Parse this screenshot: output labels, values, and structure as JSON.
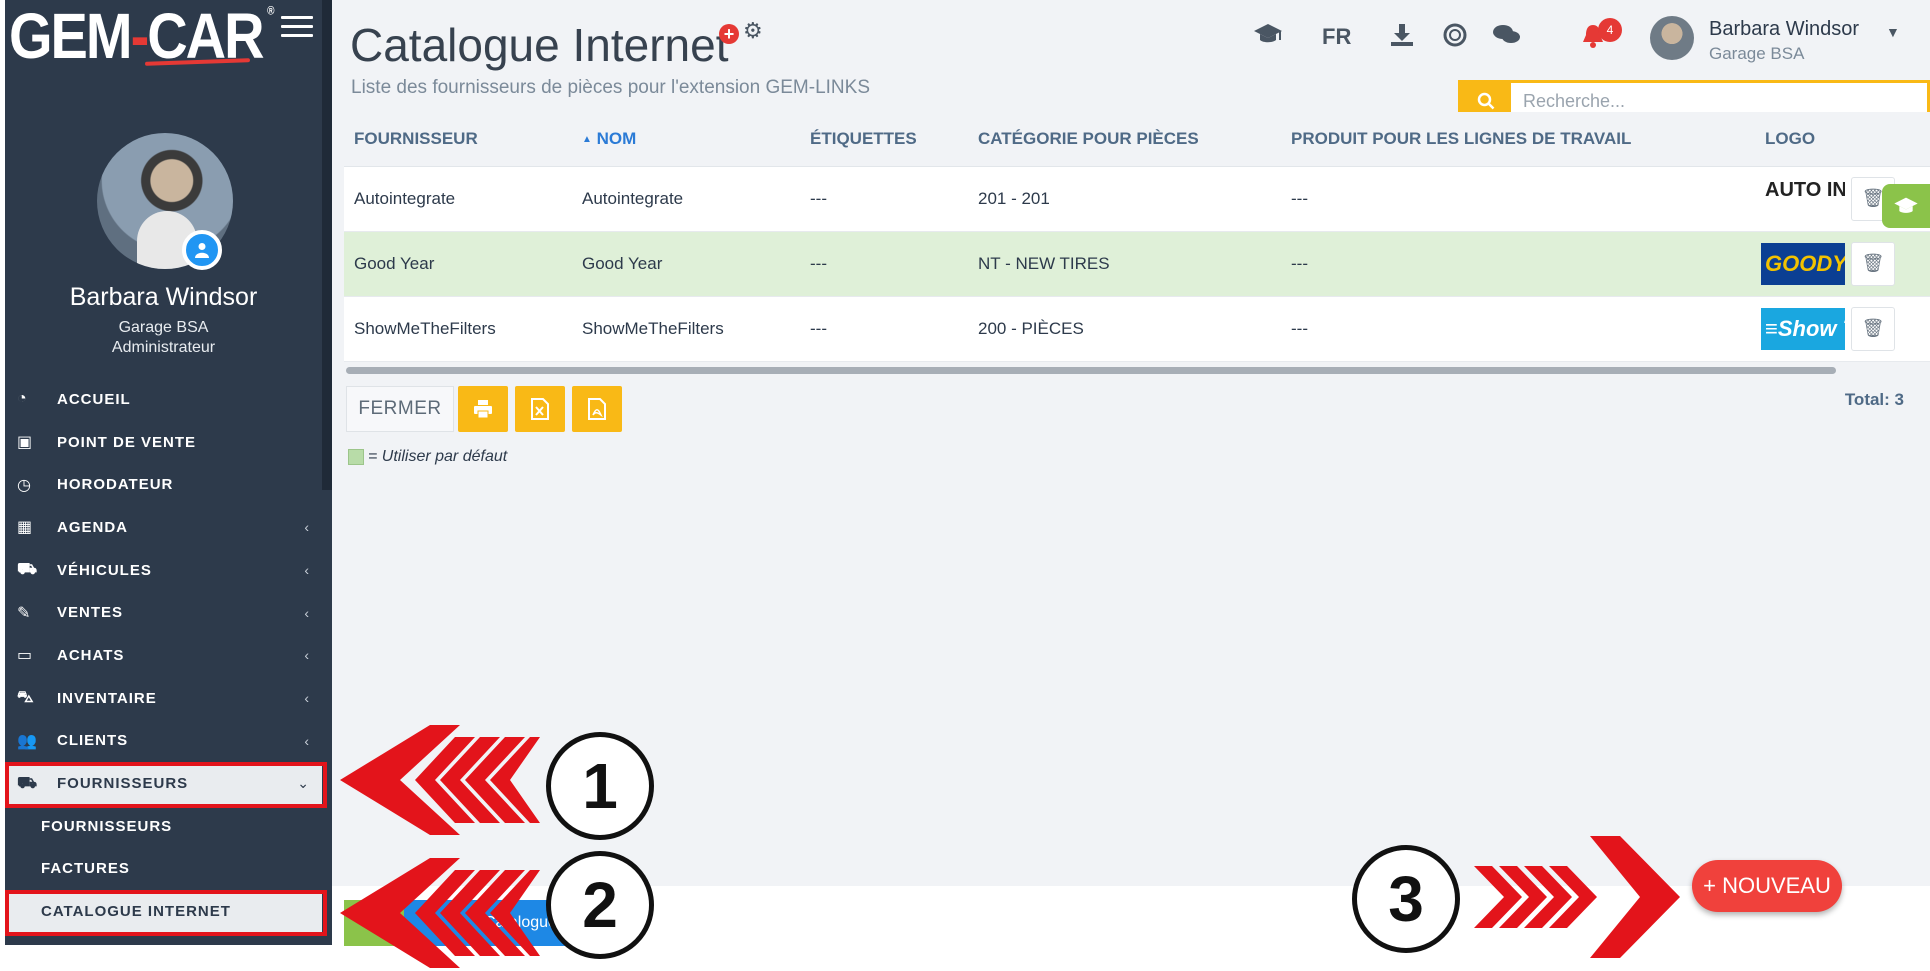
{
  "brand": {
    "logo_text_left": "GEM",
    "logo_text_right": "CAR",
    "logo_reg": "®"
  },
  "profile": {
    "name": "Barbara Windsor",
    "garage": "Garage BSA",
    "role": "Administrateur"
  },
  "menu": {
    "items": [
      {
        "label": "ACCUEIL",
        "icon": "dashboard-icon",
        "glyph": "◔"
      },
      {
        "label": "POINT DE VENTE",
        "icon": "cash-icon",
        "glyph": "▣"
      },
      {
        "label": "HORODATEUR",
        "icon": "clock-icon",
        "glyph": "◷"
      },
      {
        "label": "AGENDA",
        "icon": "calendar-icon",
        "glyph": "▦",
        "chevron": "‹"
      },
      {
        "label": "VÉHICULES",
        "icon": "car-icon",
        "glyph": "⛟",
        "chevron": "‹"
      },
      {
        "label": "VENTES",
        "icon": "edit-icon",
        "glyph": "✎",
        "chevron": "‹"
      },
      {
        "label": "ACHATS",
        "icon": "credit-card-icon",
        "glyph": "▭",
        "chevron": "‹"
      },
      {
        "label": "INVENTAIRE",
        "icon": "cart-icon",
        "glyph": "⛍",
        "chevron": "‹"
      },
      {
        "label": "CLIENTS",
        "icon": "users-icon",
        "glyph": "👥",
        "chevron": "‹"
      },
      {
        "label": "FOURNISSEURS",
        "icon": "truck-icon",
        "glyph": "⛟",
        "chevron": "⌄"
      }
    ],
    "submenu": [
      "FOURNISSEURS",
      "FACTURES",
      "CATALOGUE INTERNET"
    ]
  },
  "header": {
    "title": "Catalogue Internet",
    "subtitle": "Liste des fournisseurs de pièces pour l'extension GEM-LINKS",
    "lang": "FR",
    "notification_count": "4",
    "user_name": "Barbara Windsor",
    "user_garage": "Garage BSA"
  },
  "search": {
    "placeholder": "Recherche..."
  },
  "table": {
    "columns": [
      "FOURNISSEUR",
      "NOM",
      "ÉTIQUETTES",
      "CATÉGORIE POUR PIÈCES",
      "PRODUIT POUR LES LIGNES DE TRAVAIL",
      "LOGO"
    ],
    "sort_indicator": "▲",
    "rows": [
      {
        "fournisseur": "Autointegrate",
        "nom": "Autointegrate",
        "etiquettes": "---",
        "categorie": "201 - 201",
        "produit": "---",
        "logo_text": "AUTO INTEG",
        "default": false
      },
      {
        "fournisseur": "Good Year",
        "nom": "Good Year",
        "etiquettes": "---",
        "categorie": "NT - NEW TIRES",
        "produit": "---",
        "logo_text": "GOODY",
        "default": true
      },
      {
        "fournisseur": "ShowMeTheFilters",
        "nom": "ShowMeTheFilters",
        "etiquettes": "---",
        "categorie": "200 - PIÈCES",
        "produit": "---",
        "logo_text": "≡Show Th",
        "default": false
      }
    ]
  },
  "actions": {
    "close_label": "FERMER",
    "total": "Total: 3"
  },
  "legend": {
    "text": "= Utiliser par défaut"
  },
  "fab": {
    "label": "+ NOUVEAU"
  },
  "footer": {
    "blue_button_partial": "Catalogue In"
  },
  "annotations": [
    "1",
    "2",
    "3"
  ],
  "colors": {
    "sidebar": "#2d3a4b",
    "accent_yellow": "#f9b916",
    "accent_red": "#f0413c",
    "default_row": "#dff0d8",
    "highlight_red": "#e3141b"
  }
}
